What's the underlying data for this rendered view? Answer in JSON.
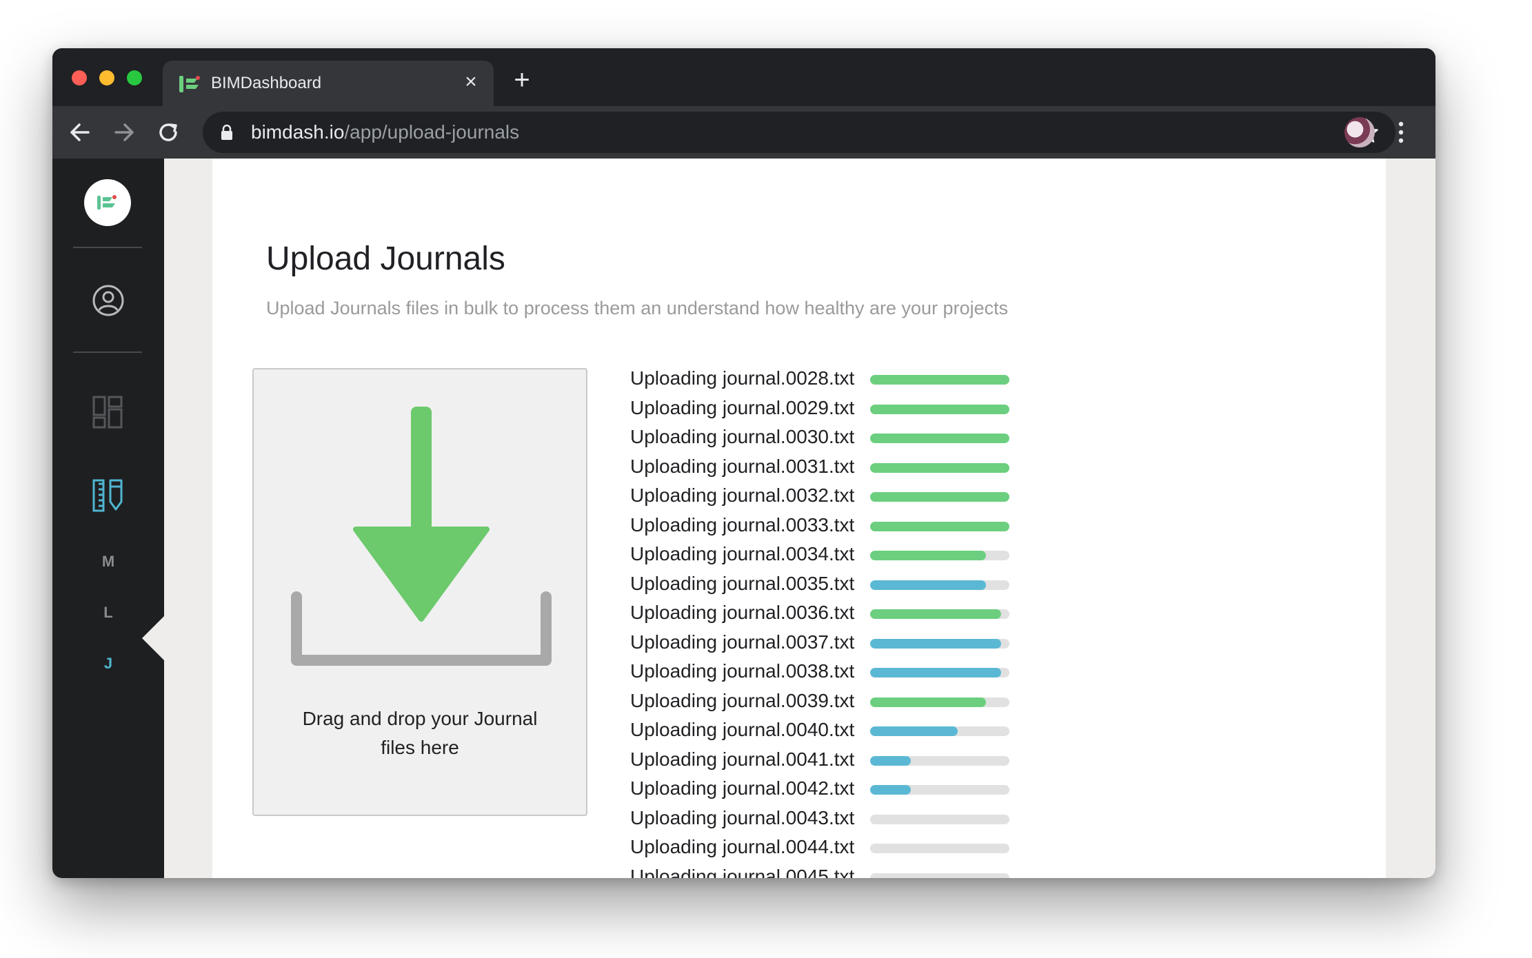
{
  "browser": {
    "tab_title": "BIMDashboard",
    "url_host": "bimdash.io",
    "url_path": "/app/upload-journals"
  },
  "sidebar": {
    "letters": [
      "M",
      "L",
      "J"
    ],
    "active_letter": "J",
    "accent_color": "#4fb6d0",
    "icons": [
      "logo-icon",
      "user-icon",
      "dashboard-icon",
      "journals-icon"
    ]
  },
  "page": {
    "title": "Upload Journals",
    "subtitle": "Upload Journals files in bulk to process them an understand how healthy are your projects"
  },
  "dropzone": {
    "line1": "Drag and drop your Journal",
    "line2": "files here",
    "arrow_color": "#6cc96c"
  },
  "colors": {
    "green": "#6ccf7f",
    "blue": "#5bb8d4",
    "track": "#e1e1e1"
  },
  "uploads": [
    {
      "label": "Uploading journal.0028.txt",
      "progress": 1.0,
      "color": "green"
    },
    {
      "label": "Uploading journal.0029.txt",
      "progress": 1.0,
      "color": "green"
    },
    {
      "label": "Uploading journal.0030.txt",
      "progress": 1.0,
      "color": "green"
    },
    {
      "label": "Uploading journal.0031.txt",
      "progress": 1.0,
      "color": "green"
    },
    {
      "label": "Uploading journal.0032.txt",
      "progress": 1.0,
      "color": "green"
    },
    {
      "label": "Uploading journal.0033.txt",
      "progress": 1.0,
      "color": "green"
    },
    {
      "label": "Uploading journal.0034.txt",
      "progress": 0.83,
      "color": "green"
    },
    {
      "label": "Uploading journal.0035.txt",
      "progress": 0.83,
      "color": "blue"
    },
    {
      "label": "Uploading journal.0036.txt",
      "progress": 0.94,
      "color": "green"
    },
    {
      "label": "Uploading journal.0037.txt",
      "progress": 0.94,
      "color": "blue"
    },
    {
      "label": "Uploading journal.0038.txt",
      "progress": 0.94,
      "color": "blue"
    },
    {
      "label": "Uploading journal.0039.txt",
      "progress": 0.83,
      "color": "green"
    },
    {
      "label": "Uploading journal.0040.txt",
      "progress": 0.63,
      "color": "blue"
    },
    {
      "label": "Uploading journal.0041.txt",
      "progress": 0.29,
      "color": "blue"
    },
    {
      "label": "Uploading journal.0042.txt",
      "progress": 0.29,
      "color": "blue"
    },
    {
      "label": "Uploading journal.0043.txt",
      "progress": 0.0,
      "color": "green"
    },
    {
      "label": "Uploading journal.0044.txt",
      "progress": 0.0,
      "color": "green"
    },
    {
      "label": "Uploading journal.0045.txt",
      "progress": 0.0,
      "color": "green"
    }
  ]
}
